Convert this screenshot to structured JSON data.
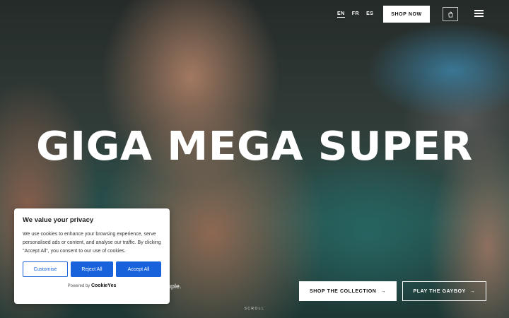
{
  "header": {
    "languages": [
      "EN",
      "FR",
      "ES"
    ],
    "active_language": "EN",
    "shop_now": "SHOP NOW",
    "cart_icon": "shopping-bag-icon",
    "menu_icon": "hamburger-menu-icon"
  },
  "hero": {
    "title": "GIGA MEGA SUPER",
    "subtitle_fragment": "ouple.",
    "cta_primary": "SHOP THE COLLECTION",
    "cta_secondary": "PLAY THE GAYBOY",
    "arrow": "→",
    "scroll_label": "SCROLL"
  },
  "cookie_banner": {
    "title": "We value your privacy",
    "body": "We use cookies to enhance your browsing experience, serve personalised ads or content, and analyse our traffic. By clicking \"Accept All\", you consent to our use of cookies.",
    "customise": "Customise",
    "reject_all": "Reject All",
    "accept_all": "Accept All",
    "powered_by": "Powered by",
    "brand": "CookieYes",
    "accent_color": "#1863dc"
  }
}
